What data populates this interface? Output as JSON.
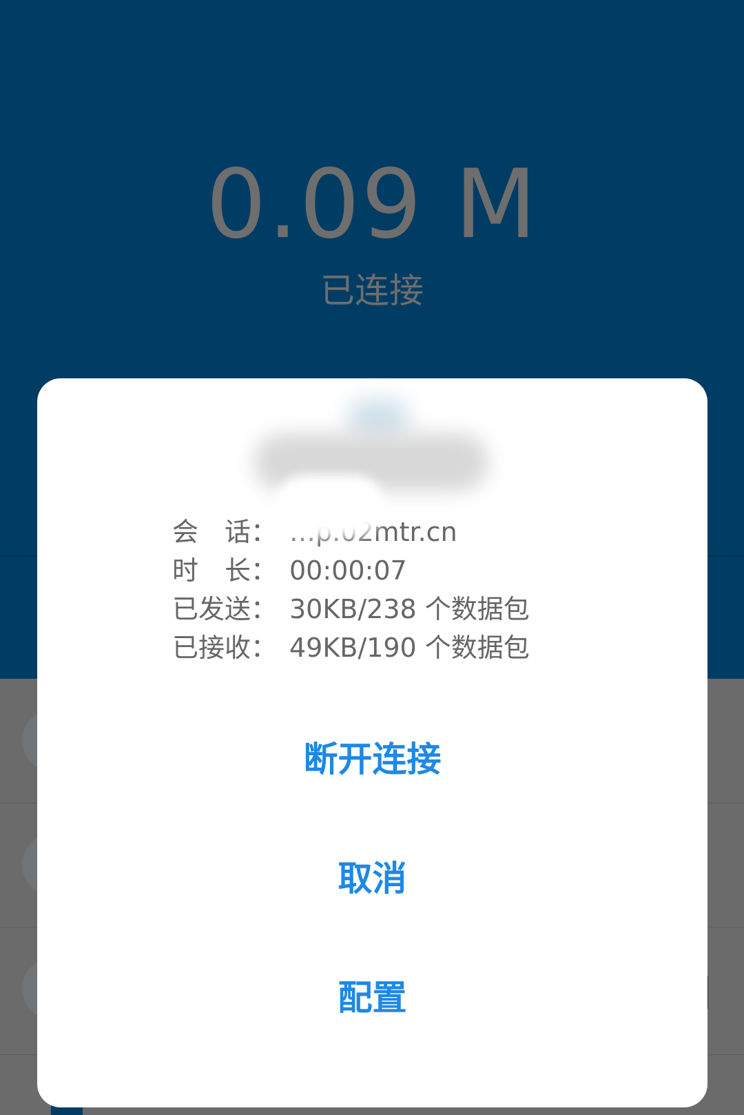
{
  "header": {
    "traffic": "0.09 M",
    "status": "已连接"
  },
  "colors": {
    "header_bg": "#003c63",
    "overlay_bg": "#6b6b6b",
    "dialog_bg": "#ffffff",
    "accent": "#1e88e5",
    "text_secondary": "#666666"
  },
  "dialog": {
    "info": [
      {
        "label": "会　话：",
        "value": "…p.02mtr.cn"
      },
      {
        "label": "时　长：",
        "value": "00:00:07"
      },
      {
        "label": "已发送：",
        "value": "30KB/238 个数据包"
      },
      {
        "label": "已接收：",
        "value": "49KB/190 个数据包"
      }
    ],
    "actions": {
      "disconnect": "断开连接",
      "cancel": "取消",
      "configure": "配置"
    }
  }
}
